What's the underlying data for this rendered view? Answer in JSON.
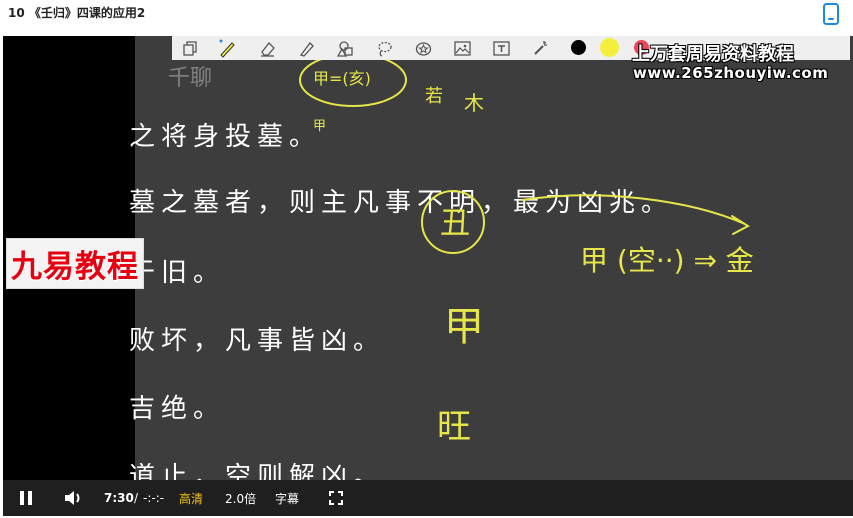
{
  "window": {
    "title": "10 《壬归》四课的应用2"
  },
  "whiteboard_toolbar": {
    "tools": [
      "copy-icon",
      "pen-icon",
      "eraser-icon",
      "highlighter-icon",
      "shapes-icon",
      "lasso-icon",
      "stamp-icon",
      "image-icon",
      "text-icon",
      "laser-pointer-icon"
    ],
    "colors": {
      "black": "#000000",
      "yellow": "#f4ef3a",
      "red": "#e8485a"
    }
  },
  "slide": {
    "lines": [
      "之将身投墓。",
      "墓之墓者，则主凡事不明，最为凶兆。",
      "于旧。",
      "败坏，凡事皆凶。",
      "吉绝。",
      "道止，空则解凶。"
    ]
  },
  "annotations": {
    "circle_top": "甲=(亥)",
    "left_small": "若",
    "right_small": "木",
    "under": "甲",
    "circled": "丑",
    "right_text": "甲 (空··) ⇒ 金",
    "vertical_1": "甲",
    "vertical_2": "旺"
  },
  "watermarks": {
    "left_brand": "九易教程",
    "top_brand": "上万套周易资料教程",
    "url": "www.265zhouyiw.com",
    "faint": "千聊"
  },
  "player": {
    "time_current": "7:30",
    "time_separator": "/",
    "time_total": "-:-:-",
    "quality": "高清",
    "speed": "2.0倍",
    "subtitles": "字幕",
    "accent_color": "#f0c419"
  }
}
